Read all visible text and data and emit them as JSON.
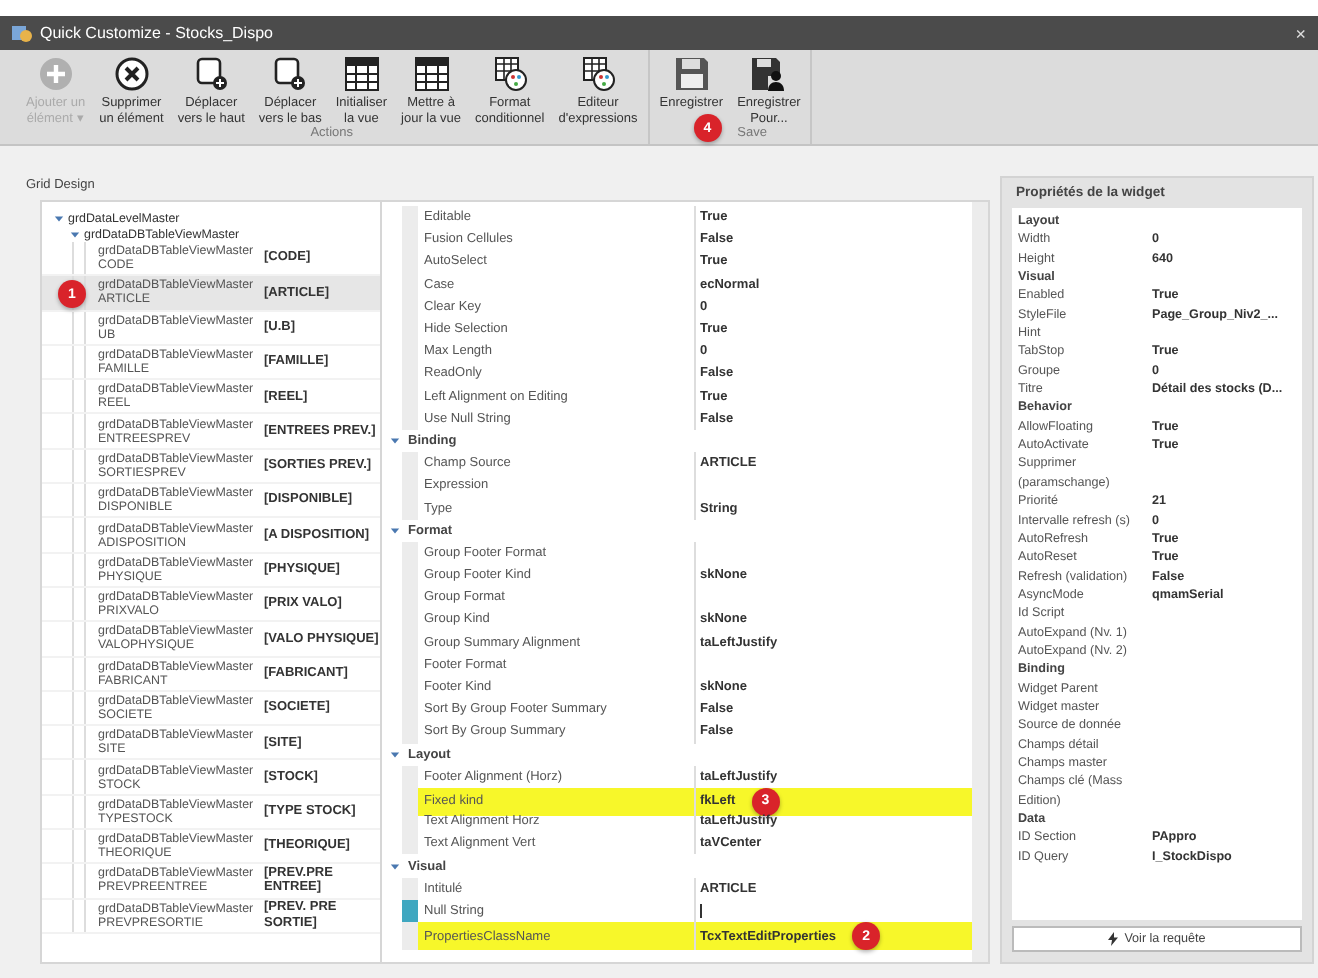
{
  "window": {
    "title": "Quick Customize - Stocks_Dispo",
    "close": "×"
  },
  "toolbar": {
    "groups": [
      {
        "label": "Actions",
        "buttons": [
          {
            "kind": "add",
            "label": "Ajouter un\nélément",
            "dropdown": "▾",
            "disabled": true
          },
          {
            "kind": "delete",
            "label": "Supprimer\nun élément",
            "disabled": false
          },
          {
            "kind": "move",
            "label": "Déplacer\nvers le haut",
            "disabled": false
          },
          {
            "kind": "move",
            "label": "Déplacer\nvers le bas",
            "disabled": false
          },
          {
            "kind": "grid",
            "label": "Initialiser\nla vue",
            "disabled": false
          },
          {
            "kind": "grid",
            "label": "Mettre à\njour la vue",
            "disabled": false
          },
          {
            "kind": "format",
            "label": "Format\nconditionnel",
            "disabled": false
          },
          {
            "kind": "format",
            "label": "Editeur\nd'expressions",
            "disabled": false
          }
        ]
      },
      {
        "label": "Save",
        "badge": "4",
        "buttons": [
          {
            "kind": "save",
            "label": "Enregistrer",
            "disabled": false
          },
          {
            "kind": "saveas",
            "label": "Enregistrer\nPour...",
            "disabled": false
          }
        ]
      }
    ]
  },
  "grid_design": {
    "title": "Grid Design",
    "tree": {
      "label": "grdDataLevelMaster",
      "expanded": true,
      "children": [
        {
          "label": "grdDataDBTableViewMaster",
          "expanded": true,
          "children": [
            {
              "name": "grdDataDBTableViewMasterCODE",
              "caption": "[CODE]",
              "selected": false
            },
            {
              "name": "grdDataDBTableViewMasterARTICLE",
              "caption": "[ARTICLE]",
              "selected": true,
              "badge": "1"
            },
            {
              "name": "grdDataDBTableViewMasterUB",
              "caption": "[U.B]",
              "selected": false
            },
            {
              "name": "grdDataDBTableViewMasterFAMILLE",
              "caption": "[FAMILLE]",
              "selected": false
            },
            {
              "name": "grdDataDBTableViewMasterREEL",
              "caption": "[REEL]",
              "selected": false
            },
            {
              "name": "grdDataDBTableViewMasterENTREESPREV",
              "caption": "[ENTREES PREV.]",
              "selected": false
            },
            {
              "name": "grdDataDBTableViewMasterSORTIESPREV",
              "caption": "[SORTIES PREV.]",
              "selected": false
            },
            {
              "name": "grdDataDBTableViewMasterDISPONIBLE",
              "caption": "[DISPONIBLE]",
              "selected": false
            },
            {
              "name": "grdDataDBTableViewMasterADISPOSITION",
              "caption": "[A DISPOSITION]",
              "selected": false
            },
            {
              "name": "grdDataDBTableViewMasterPHYSIQUE",
              "caption": "[PHYSIQUE]",
              "selected": false
            },
            {
              "name": "grdDataDBTableViewMasterPRIXVALO",
              "caption": "[PRIX VALO]",
              "selected": false
            },
            {
              "name": "grdDataDBTableViewMasterVALOPHYSIQUE",
              "caption": "[VALO PHYSIQUE]",
              "selected": false
            },
            {
              "name": "grdDataDBTableViewMasterFABRICANT",
              "caption": "[FABRICANT]",
              "selected": false
            },
            {
              "name": "grdDataDBTableViewMasterSOCIETE",
              "caption": "[SOCIETE]",
              "selected": false
            },
            {
              "name": "grdDataDBTableViewMasterSITE",
              "caption": "[SITE]",
              "selected": false
            },
            {
              "name": "grdDataDBTableViewMasterSTOCK",
              "caption": "[STOCK]",
              "selected": false
            },
            {
              "name": "grdDataDBTableViewMasterTYPESTOCK",
              "caption": "[TYPE STOCK]",
              "selected": false
            },
            {
              "name": "grdDataDBTableViewMasterTHEORIQUE",
              "caption": "[THEORIQUE]",
              "selected": false
            },
            {
              "name": "grdDataDBTableViewMasterPREVPREENTREE",
              "caption": "[PREV.PRE ENTREE]",
              "selected": false
            },
            {
              "name": "grdDataDBTableViewMasterPREVPRESORTIE",
              "caption": "[PREV. PRE SORTIE]",
              "selected": false
            }
          ]
        }
      ]
    },
    "properties": [
      {
        "rows": [
          {
            "name": "Editable",
            "value": "True",
            "highlighted": false,
            "focused": false
          },
          {
            "name": "Fusion Cellules",
            "value": "False",
            "highlighted": false,
            "focused": false
          },
          {
            "name": "AutoSelect",
            "value": "True",
            "highlighted": false,
            "focused": false
          },
          {
            "name": "Case",
            "value": "ecNormal",
            "highlighted": false,
            "focused": false
          },
          {
            "name": "Clear Key",
            "value": "0",
            "highlighted": false,
            "focused": false
          },
          {
            "name": "Hide Selection",
            "value": "True",
            "highlighted": false,
            "focused": false
          },
          {
            "name": "Max Length",
            "value": "0",
            "highlighted": false,
            "focused": false
          },
          {
            "name": "ReadOnly",
            "value": "False",
            "highlighted": false,
            "focused": false
          },
          {
            "name": "Left Alignment on Editing",
            "value": "True",
            "highlighted": false,
            "focused": false
          },
          {
            "name": "Use Null String",
            "value": "False",
            "highlighted": false,
            "focused": false
          }
        ]
      },
      {
        "title": "Binding",
        "expanded": true,
        "rows": [
          {
            "name": "Champ Source",
            "value": "ARTICLE",
            "highlighted": false,
            "focused": false
          },
          {
            "name": "Expression",
            "highlighted": false,
            "focused": false
          },
          {
            "name": "Type",
            "value": "String",
            "highlighted": false,
            "focused": false
          }
        ]
      },
      {
        "title": "Format",
        "expanded": true,
        "rows": [
          {
            "name": "Group Footer Format",
            "highlighted": false,
            "focused": false
          },
          {
            "name": "Group Footer Kind",
            "value": "skNone",
            "highlighted": false,
            "focused": false
          },
          {
            "name": "Group Format",
            "highlighted": false,
            "focused": false
          },
          {
            "name": "Group Kind",
            "value": "skNone",
            "highlighted": false,
            "focused": false
          },
          {
            "name": "Group Summary Alignment",
            "value": "taLeftJustify",
            "highlighted": false,
            "focused": false
          },
          {
            "name": "Footer Format",
            "highlighted": false,
            "focused": false
          },
          {
            "name": "Footer Kind",
            "value": "skNone",
            "highlighted": false,
            "focused": false
          },
          {
            "name": "Sort By Group Footer Summary",
            "value": "False",
            "highlighted": false,
            "focused": false
          },
          {
            "name": "Sort By Group Summary",
            "value": "False",
            "highlighted": false,
            "focused": false
          }
        ]
      },
      {
        "title": "Layout",
        "expanded": true,
        "rows": [
          {
            "name": "Footer Alignment (Horz)",
            "value": "taLeftJustify",
            "highlighted": false,
            "focused": false
          },
          {
            "name": "Fixed kind",
            "value": "fkLeft",
            "highlighted": true,
            "focused": false,
            "badge": "3"
          },
          {
            "name": "Text Alignment Horz",
            "value": "taLeftJustify",
            "highlighted": false,
            "focused": false
          },
          {
            "name": "Text Alignment Vert",
            "value": "taVCenter",
            "highlighted": false,
            "focused": false
          }
        ]
      },
      {
        "title": "Visual",
        "expanded": true,
        "rows": [
          {
            "name": "Intitulé",
            "value": "ARTICLE",
            "highlighted": false,
            "focused": false
          },
          {
            "name": "Null String",
            "highlighted": false,
            "focused": true
          },
          {
            "name": "PropertiesClassName",
            "value": "TcxTextEditProperties",
            "highlighted": true,
            "focused": false,
            "badge": "2"
          }
        ]
      }
    ]
  },
  "widget_panel": {
    "title": "Propriétés de la widget",
    "rows": [
      {
        "kind": "section",
        "label": "Layout"
      },
      {
        "kind": "prop",
        "label": "Width",
        "value": "0"
      },
      {
        "kind": "prop",
        "label": "Height",
        "value": "640"
      },
      {
        "kind": "section",
        "label": "Visual"
      },
      {
        "kind": "prop",
        "label": "Enabled",
        "value": "True"
      },
      {
        "kind": "prop",
        "label": "StyleFile",
        "value": "Page_Group_Niv2_..."
      },
      {
        "kind": "prop",
        "label": "Hint"
      },
      {
        "kind": "prop",
        "label": "TabStop",
        "value": "True"
      },
      {
        "kind": "prop",
        "label": "Groupe",
        "value": "0"
      },
      {
        "kind": "prop",
        "label": "Titre",
        "value": "Détail des stocks (D..."
      },
      {
        "kind": "section",
        "label": "Behavior"
      },
      {
        "kind": "prop",
        "label": "AllowFloating",
        "value": "True"
      },
      {
        "kind": "prop",
        "label": "AutoActivate",
        "value": "True"
      },
      {
        "kind": "prop",
        "label": "Supprimer (paramschange)"
      },
      {
        "kind": "prop",
        "label": "Priorité",
        "value": "21"
      },
      {
        "kind": "prop",
        "label": "Intervalle refresh (s)",
        "value": "0"
      },
      {
        "kind": "prop",
        "label": "AutoRefresh",
        "value": "True"
      },
      {
        "kind": "prop",
        "label": "AutoReset",
        "value": "True"
      },
      {
        "kind": "prop",
        "label": "Refresh (validation)",
        "value": "False"
      },
      {
        "kind": "prop",
        "label": "AsyncMode",
        "value": "qmamSerial"
      },
      {
        "kind": "prop",
        "label": "Id Script"
      },
      {
        "kind": "prop",
        "label": "AutoExpand (Nv. 1)"
      },
      {
        "kind": "prop",
        "label": "AutoExpand (Nv. 2)"
      },
      {
        "kind": "section",
        "label": "Binding"
      },
      {
        "kind": "prop",
        "label": "Widget Parent"
      },
      {
        "kind": "prop",
        "label": "Widget master"
      },
      {
        "kind": "prop",
        "label": "Source de donnée"
      },
      {
        "kind": "prop",
        "label": "Champs détail"
      },
      {
        "kind": "prop",
        "label": "Champs master"
      },
      {
        "kind": "prop",
        "label": "Champs clé (Mass Edition)"
      },
      {
        "kind": "section",
        "label": "Data"
      },
      {
        "kind": "prop",
        "label": "ID Section",
        "value": "PAppro"
      },
      {
        "kind": "prop",
        "label": "ID Query",
        "value": "I_StockDispo"
      }
    ],
    "button": "Voir la requête"
  }
}
